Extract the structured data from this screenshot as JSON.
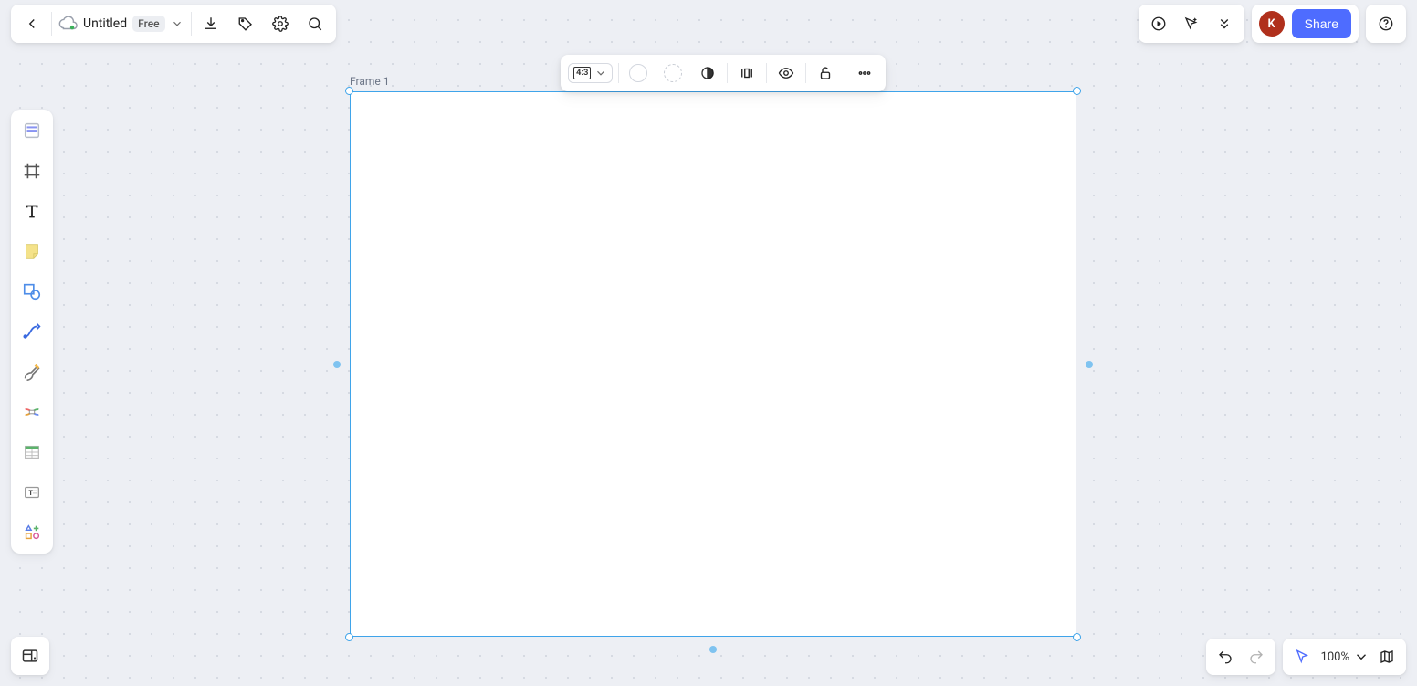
{
  "header": {
    "doc_title": "Untitled",
    "plan_badge": "Free",
    "share_label": "Share",
    "avatar_initial": "K"
  },
  "canvas": {
    "frame_label": "Frame 1"
  },
  "ctx_toolbar": {
    "aspect_ratio": "4:3"
  },
  "bottom_right": {
    "zoom_label": "100%"
  }
}
